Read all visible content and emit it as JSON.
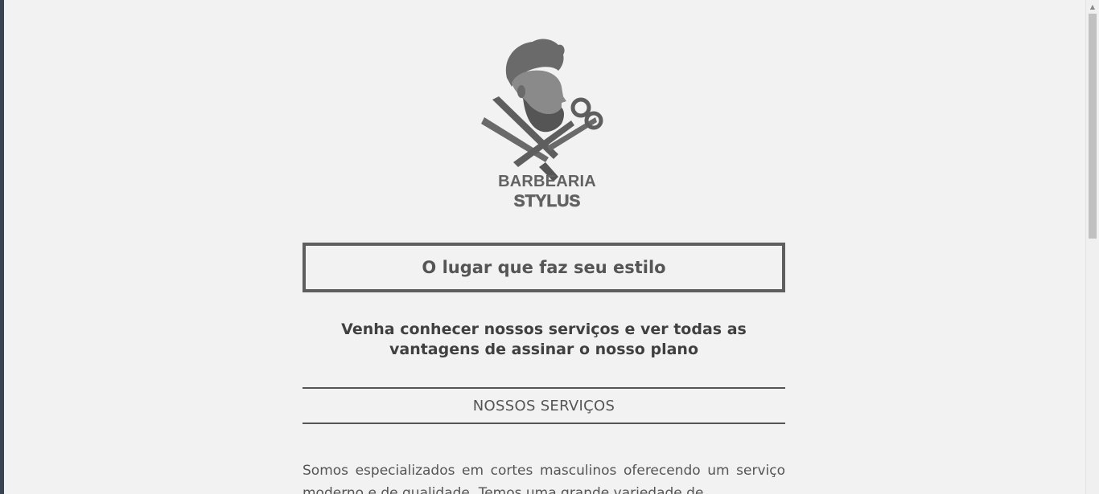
{
  "brand": {
    "line1": "BARBEARIA",
    "line2": "STYLUS",
    "color": "#626262"
  },
  "hero": {
    "tagline": "O lugar que faz seu estilo",
    "invite": "Venha conhecer nossos serviços e ver todas as vantagens de assinar o nosso plano"
  },
  "services": {
    "heading": "NOSSOS SERVIÇOS",
    "description": "Somos especializados em cortes masculinos oferecendo um serviço moderno e de qualidade. Temos uma grande variedade de"
  },
  "icons": {
    "logo": "barber-logo-icon",
    "razor": "razor-icon",
    "scissors": "scissors-icon",
    "scroll_up": "arrow-up-icon"
  },
  "colors": {
    "background": "#f2f2f2",
    "text": "#555555",
    "border": "#5e5e5e"
  }
}
